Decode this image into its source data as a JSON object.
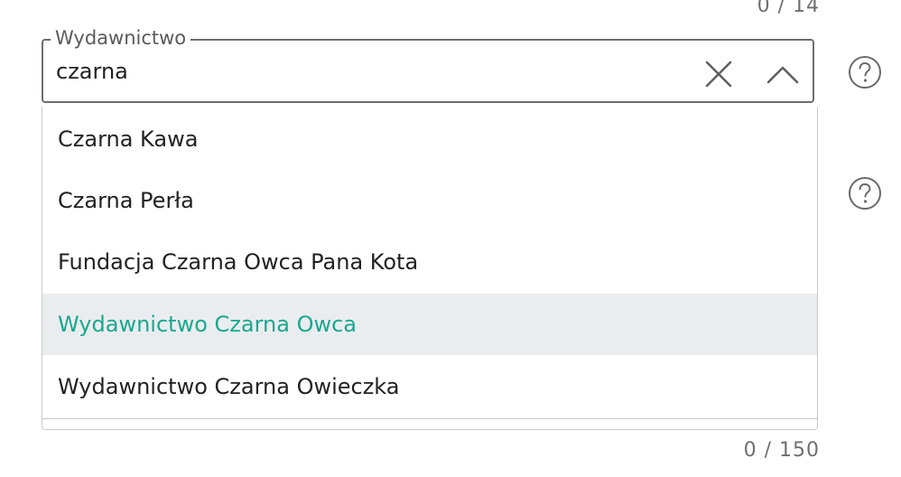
{
  "counters": {
    "top": "0 / 14",
    "bottom": "0 / 150"
  },
  "publisher_field": {
    "label": "Wydawnictwo",
    "value": "czarna",
    "clear_icon": "close-icon",
    "toggle_icon": "chevron-up-icon"
  },
  "help_icons": [
    "help-circle-icon",
    "help-circle-icon"
  ],
  "dropdown": {
    "options": [
      "Czarna Kawa",
      "Czarna Perła",
      "Fundacja Czarna Owca Pana Kota",
      "Wydawnictwo Czarna Owca",
      "Wydawnictwo Czarna Owieczka"
    ],
    "highlighted": "Wydawnictwo Czarna Owca"
  },
  "colors": {
    "highlight_text": "#1aa88f",
    "highlight_bg": "#eaedef",
    "border": "#6e6e6e",
    "muted_text": "#6f6f6f"
  }
}
